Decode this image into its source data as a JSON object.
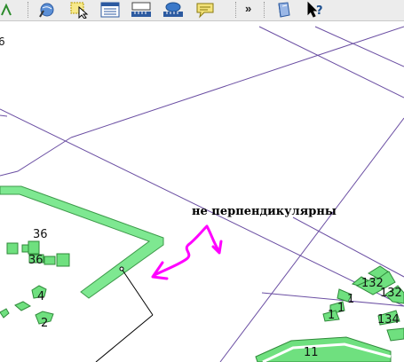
{
  "toolbar": {
    "more_label": "»",
    "buttons": [
      {
        "icon": "pan-icon"
      },
      {
        "icon": "globe-info-icon"
      },
      {
        "icon": "select-features-icon"
      },
      {
        "icon": "attribute-table-icon"
      },
      {
        "icon": "measure-ruler-icon"
      },
      {
        "icon": "measure-area-icon"
      },
      {
        "icon": "map-tips-icon"
      },
      {
        "icon": "help-book-icon"
      },
      {
        "icon": "whats-this-icon"
      }
    ]
  },
  "map": {
    "corner_label": "6",
    "annotation": "не перпендикулярны",
    "annotation_color": "#ff00ff",
    "building_fill": "#6fe07f",
    "road_fill": "#7ee891",
    "parcel_line_color": "#6b4fa3",
    "labels": {
      "b36_top": "36",
      "b36_bottom": "36",
      "b4": "4",
      "b2": "2",
      "b132_top": "132",
      "b132_right": "132",
      "b1_a": "1",
      "b1_b": "1",
      "b1_c": "1",
      "b134": "134",
      "b11": "11"
    }
  }
}
